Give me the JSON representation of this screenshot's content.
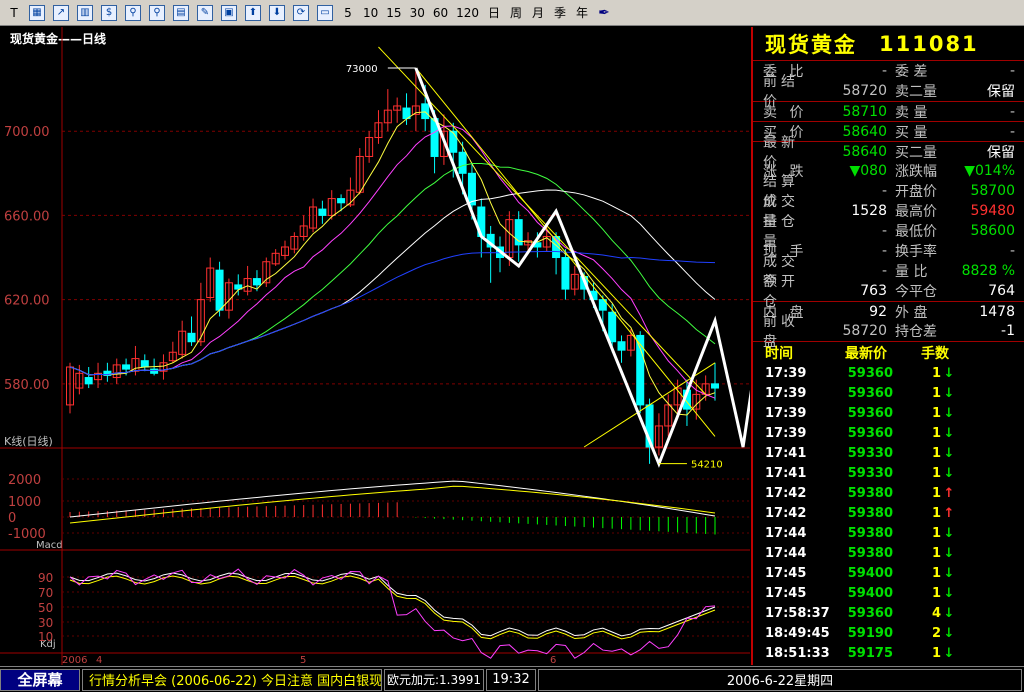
{
  "toolbar": {
    "items": [
      "T",
      "5",
      "10",
      "15",
      "30",
      "60",
      "120",
      "日",
      "周",
      "月",
      "季",
      "年"
    ]
  },
  "chart": {
    "title": "现货黄金——日线",
    "k_label": "K线(日线)",
    "macd_label": "Macd",
    "kdj_label": "Kdj",
    "high_label": "73000",
    "low_label": "54210",
    "price_ticks": [
      "700.00",
      "660.00",
      "620.00",
      "580.00"
    ],
    "macd_ticks": [
      "2000",
      "1000",
      "0",
      "-1000"
    ],
    "kdj_ticks": [
      "90",
      "70",
      "50",
      "30",
      "10"
    ],
    "date_labels": [
      "2006",
      "4",
      "5",
      "6"
    ]
  },
  "chart_data": {
    "type": "candlestick",
    "title": "现货黄金——日线",
    "ylim": [
      550,
      740
    ],
    "y_ticks": [
      700,
      660,
      620,
      580
    ],
    "high": 730.0,
    "low": 542.1,
    "candles": [
      [
        570,
        588,
        566,
        590
      ],
      [
        578,
        585,
        575,
        589
      ],
      [
        583,
        580,
        578,
        588
      ],
      [
        582,
        585,
        578,
        590
      ],
      [
        586,
        584,
        581,
        590
      ],
      [
        583,
        589,
        580,
        592
      ],
      [
        589,
        587,
        584,
        592
      ],
      [
        586,
        592,
        584,
        598
      ],
      [
        591,
        588,
        586,
        594
      ],
      [
        587,
        585,
        584,
        592
      ],
      [
        586,
        590,
        582,
        594
      ],
      [
        591,
        595,
        590,
        600
      ],
      [
        594,
        605,
        592,
        610
      ],
      [
        604,
        600,
        598,
        612
      ],
      [
        600,
        620,
        598,
        628
      ],
      [
        621,
        635,
        619,
        640
      ],
      [
        634,
        615,
        612,
        638
      ],
      [
        615,
        628,
        611,
        630
      ],
      [
        627,
        625,
        622,
        632
      ],
      [
        624,
        630,
        622,
        636
      ],
      [
        630,
        627,
        624,
        634
      ],
      [
        628,
        638,
        626,
        640
      ],
      [
        637,
        642,
        636,
        644
      ],
      [
        641,
        645,
        639,
        648
      ],
      [
        644,
        650,
        642,
        652
      ],
      [
        650,
        655,
        648,
        660
      ],
      [
        654,
        664,
        652,
        668
      ],
      [
        663,
        660,
        656,
        667
      ],
      [
        660,
        668,
        658,
        672
      ],
      [
        668,
        666,
        662,
        670
      ],
      [
        665,
        672,
        664,
        678
      ],
      [
        671,
        688,
        670,
        692
      ],
      [
        688,
        697,
        685,
        700
      ],
      [
        697,
        704,
        694,
        710
      ],
      [
        704,
        710,
        700,
        720
      ],
      [
        710,
        712,
        704,
        716
      ],
      [
        711,
        706,
        703,
        718
      ],
      [
        708,
        712,
        700,
        730
      ],
      [
        713,
        706,
        700,
        722
      ],
      [
        706,
        688,
        680,
        710
      ],
      [
        688,
        700,
        684,
        708
      ],
      [
        700,
        690,
        678,
        704
      ],
      [
        690,
        680,
        670,
        695
      ],
      [
        680,
        665,
        658,
        685
      ],
      [
        664,
        650,
        640,
        668
      ],
      [
        651,
        645,
        628,
        655
      ],
      [
        645,
        640,
        633,
        650
      ],
      [
        640,
        658,
        636,
        662
      ],
      [
        658,
        646,
        638,
        662
      ],
      [
        646,
        648,
        642,
        652
      ],
      [
        647,
        645,
        640,
        652
      ],
      [
        645,
        650,
        643,
        656
      ],
      [
        650,
        640,
        632,
        652
      ],
      [
        640,
        625,
        620,
        644
      ],
      [
        625,
        632,
        622,
        636
      ],
      [
        631,
        625,
        620,
        633
      ],
      [
        624,
        620,
        616,
        628
      ],
      [
        620,
        615,
        605,
        622
      ],
      [
        614,
        600,
        595,
        618
      ],
      [
        600,
        596,
        590,
        603
      ],
      [
        596,
        603,
        593,
        606
      ],
      [
        603,
        570,
        566,
        605
      ],
      [
        570,
        550,
        542,
        573
      ],
      [
        550,
        560,
        546,
        566
      ],
      [
        560,
        570,
        555,
        575
      ],
      [
        570,
        578,
        566,
        582
      ],
      [
        577,
        568,
        560,
        582
      ],
      [
        568,
        575,
        563,
        582
      ],
      [
        575,
        580,
        572,
        584
      ],
      [
        580,
        578,
        572,
        590
      ]
    ]
  },
  "quote": {
    "name": "现货黄金",
    "code": "111081",
    "rows": [
      {
        "l1": "委 比",
        "v1": "-",
        "l2": "委 差",
        "v2": "-",
        "c1": "",
        "c2": ""
      },
      {
        "l1": "前结价",
        "v1": "58720",
        "l2": "卖二量",
        "v2": "保留",
        "c1": "",
        "c2": "wht"
      },
      {
        "l1": "卖 价",
        "v1": "58710",
        "l2": "卖 量",
        "v2": "-",
        "c1": "grn",
        "c2": "",
        "sep": true
      },
      {
        "l1": "买 价",
        "v1": "58640",
        "l2": "买 量",
        "v2": "-",
        "c1": "grn",
        "c2": "",
        "sep": true
      },
      {
        "l1": "最新价",
        "v1": "58640",
        "l2": "买二量",
        "v2": "保留",
        "c1": "grn",
        "c2": "wht",
        "sep": true
      },
      {
        "l1": "涨 跌",
        "v1": "▼080",
        "l2": "涨跌幅",
        "v2": "▼014%",
        "c1": "grn",
        "c2": "grn"
      },
      {
        "l1": "结算价",
        "v1": "-",
        "l2": "开盘价",
        "v2": "58700",
        "c1": "",
        "c2": "grn"
      },
      {
        "l1": "成交量",
        "v1": "1528",
        "l2": "最高价",
        "v2": "59480",
        "c1": "wht",
        "c2": "red"
      },
      {
        "l1": "持仓量",
        "v1": "-",
        "l2": "最低价",
        "v2": "58600",
        "c1": "",
        "c2": "grn"
      },
      {
        "l1": "现 手",
        "v1": "-",
        "l2": "换手率",
        "v2": "-",
        "c1": "",
        "c2": ""
      },
      {
        "l1": "成交额",
        "v1": "-",
        "l2": "量 比",
        "v2": "8828 %",
        "c1": "",
        "c2": "grn"
      },
      {
        "l1": "今开仓",
        "v1": "763",
        "l2": "今平仓",
        "v2": "764",
        "c1": "wht",
        "c2": "wht"
      },
      {
        "l1": "内 盘",
        "v1": "92",
        "l2": "外 盘",
        "v2": "1478",
        "c1": "wht",
        "c2": "wht",
        "sep": true
      },
      {
        "l1": "前收盘",
        "v1": "58720",
        "l2": "持仓差",
        "v2": "-1",
        "c1": "",
        "c2": "wht"
      }
    ]
  },
  "ticks": {
    "headers": [
      "时间",
      "最新价",
      "手数"
    ],
    "rows": [
      {
        "t": "17:39",
        "p": "59360",
        "q": "1",
        "d": "down"
      },
      {
        "t": "17:39",
        "p": "59360",
        "q": "1",
        "d": "down"
      },
      {
        "t": "17:39",
        "p": "59360",
        "q": "1",
        "d": "down"
      },
      {
        "t": "17:39",
        "p": "59360",
        "q": "1",
        "d": "down"
      },
      {
        "t": "17:41",
        "p": "59330",
        "q": "1",
        "d": "down"
      },
      {
        "t": "17:41",
        "p": "59330",
        "q": "1",
        "d": "down"
      },
      {
        "t": "17:42",
        "p": "59380",
        "q": "1",
        "d": "up"
      },
      {
        "t": "17:42",
        "p": "59380",
        "q": "1",
        "d": "up"
      },
      {
        "t": "17:44",
        "p": "59380",
        "q": "1",
        "d": "down"
      },
      {
        "t": "17:44",
        "p": "59380",
        "q": "1",
        "d": "down"
      },
      {
        "t": "17:45",
        "p": "59400",
        "q": "1",
        "d": "down"
      },
      {
        "t": "17:45",
        "p": "59400",
        "q": "1",
        "d": "down"
      },
      {
        "t": "17:58:37",
        "p": "59360",
        "q": "4",
        "d": "down"
      },
      {
        "t": "18:49:45",
        "p": "59190",
        "q": "2",
        "d": "down"
      },
      {
        "t": "18:51:33",
        "p": "59175",
        "q": "1",
        "d": "down"
      }
    ]
  },
  "status": {
    "fullscreen": "全屏幕",
    "news": "行情分析早会 (2006-06-22) 今日注意 国内白银现货价格整体企稳并有所上涨",
    "fx": "欧元加元:1.3991",
    "time": "19:32",
    "date": "2006-6-22星期四"
  }
}
